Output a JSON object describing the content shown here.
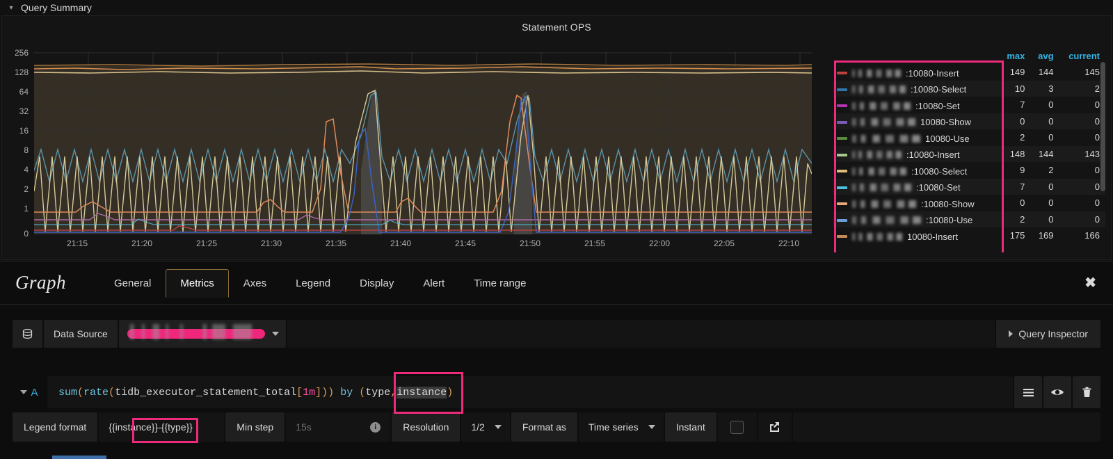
{
  "row": {
    "title": "Query Summary",
    "collapse_icon": "chevron-down-icon"
  },
  "panel": {
    "title": "Statement OPS",
    "y_axis": {
      "scale": "log2",
      "ticks": [
        "256",
        "128",
        "64",
        "32",
        "16",
        "8",
        "4",
        "2",
        "1",
        "0"
      ]
    },
    "x_axis": {
      "ticks": [
        "21:15",
        "21:20",
        "21:25",
        "21:30",
        "21:35",
        "21:40",
        "21:45",
        "21:50",
        "21:55",
        "22:00",
        "22:05",
        "22:10"
      ]
    }
  },
  "legend": {
    "columns": [
      "max",
      "avg",
      "current"
    ],
    "rows": [
      {
        "color": "#bf4040",
        "ip_redacted": true,
        "label": ":10080-Insert",
        "max": "149",
        "avg": "144",
        "current": "145"
      },
      {
        "color": "#3274a8",
        "ip_redacted": true,
        "label": ":10080-Select",
        "max": "10",
        "avg": "3",
        "current": "2"
      },
      {
        "color": "#b433b4",
        "ip_redacted": true,
        "label": ":10080-Set",
        "max": "7",
        "avg": "0",
        "current": "0"
      },
      {
        "color": "#7b5bb8",
        "ip_redacted": true,
        "label": " 10080-Show",
        "max": "0",
        "avg": "0",
        "current": "0"
      },
      {
        "color": "#5a8a3c",
        "ip_redacted": true,
        "label": " 10080-Use",
        "max": "2",
        "avg": "0",
        "current": "0"
      },
      {
        "color": "#a8c98a",
        "ip_redacted": true,
        "label": ":10080-Insert",
        "max": "148",
        "avg": "144",
        "current": "143"
      },
      {
        "color": "#e0bb7a",
        "ip_redacted": true,
        "label": ":10080-Select",
        "max": "9",
        "avg": "2",
        "current": "0"
      },
      {
        "color": "#4cc0de",
        "ip_redacted": true,
        "label": ":10080-Set",
        "max": "7",
        "avg": "0",
        "current": "0"
      },
      {
        "color": "#e6a87a",
        "ip_redacted": true,
        "label": ":10080-Show",
        "max": "0",
        "avg": "0",
        "current": "0"
      },
      {
        "color": "#6b9ed6",
        "ip_redacted": true,
        "label": ":10080-Use",
        "max": "2",
        "avg": "0",
        "current": "0"
      },
      {
        "color": "#c08a5a",
        "ip_redacted": true,
        "label": "10080-Insert",
        "max": "175",
        "avg": "169",
        "current": "166"
      }
    ]
  },
  "editor": {
    "kind": "Graph",
    "tabs": [
      {
        "label": "General",
        "active": false
      },
      {
        "label": "Metrics",
        "active": true
      },
      {
        "label": "Axes",
        "active": false
      },
      {
        "label": "Legend",
        "active": false
      },
      {
        "label": "Display",
        "active": false
      },
      {
        "label": "Alert",
        "active": false
      },
      {
        "label": "Time range",
        "active": false
      }
    ],
    "close_icon": "close-icon",
    "datasource": {
      "db_icon": "database-icon",
      "label": "Data Source",
      "value_redacted": true,
      "value": "",
      "caret_icon": "chevron-down-icon"
    },
    "query_inspector": {
      "label": "Query Inspector",
      "caret_icon": "chevron-right-icon"
    },
    "query": {
      "ref_id": "A",
      "toggle_icon": "chevron-down-icon",
      "expression_tokens": [
        {
          "t": "sum",
          "k": "fn"
        },
        {
          "t": "(",
          "k": "paren"
        },
        {
          "t": "rate",
          "k": "fn"
        },
        {
          "t": "(",
          "k": "paren"
        },
        {
          "t": "tidb_executor_statement_total",
          "k": "metric"
        },
        {
          "t": "[",
          "k": "paren"
        },
        {
          "t": "1m",
          "k": "num"
        },
        {
          "t": "]",
          "k": "paren"
        },
        {
          "t": ")",
          "k": "paren"
        },
        {
          "t": ")",
          "k": "paren"
        },
        {
          "t": " by ",
          "k": "by"
        },
        {
          "t": "(",
          "k": "paren"
        },
        {
          "t": "type",
          "k": "label"
        },
        {
          "t": ",",
          "k": "paren"
        },
        {
          "t": "instance",
          "k": "sel"
        },
        {
          "t": ")",
          "k": "paren"
        }
      ],
      "expression_plain": "sum(rate(tidb_executor_statement_total[1m])) by (type,instance)",
      "actions": [
        {
          "icon": "hamburger-icon",
          "name": "query-options"
        },
        {
          "icon": "eye-icon",
          "name": "toggle-query-visibility"
        },
        {
          "icon": "trash-icon",
          "name": "remove-query"
        }
      ]
    },
    "options": {
      "legend_format_label": "Legend format",
      "legend_format_value": "{{instance}}-{{type}}",
      "min_step_label": "Min step",
      "min_step_placeholder": "15s",
      "min_step_value": "",
      "min_step_info_icon": "info-icon",
      "resolution_label": "Resolution",
      "resolution_value": "1/2",
      "format_as_label": "Format as",
      "format_as_value": "Time series",
      "instant_label": "Instant",
      "instant_checked": false,
      "share_icon": "external-link-icon"
    }
  },
  "colors": {
    "accent_blue": "#33b5e5",
    "annotation_pink": "#ed2a7b",
    "panel_bg": "#141414",
    "page_bg": "#111111"
  }
}
